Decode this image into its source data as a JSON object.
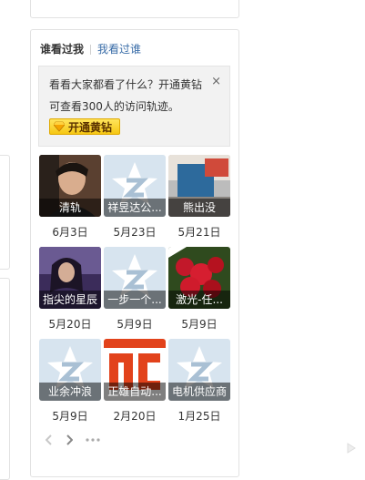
{
  "tabs": {
    "active": "谁看过我",
    "inactive": "我看过谁"
  },
  "notice": {
    "line1": "看看大家都看了什么？开通黄钻",
    "line2": "可查看300人的访问轨迹。",
    "close_glyph": "×",
    "button_label": "开通黄钻"
  },
  "visitors": [
    {
      "name": "清轨",
      "date": "6月3日"
    },
    {
      "name": "祥昱达公...",
      "date": "5月23日"
    },
    {
      "name": "熊出没",
      "date": "5月21日"
    },
    {
      "name": "指尖的星辰",
      "date": "5月20日"
    },
    {
      "name": "一步一个...",
      "date": "5月9日"
    },
    {
      "name": "激光-任...",
      "date": "5月9日"
    },
    {
      "name": "业余冲浪",
      "date": "5月9日"
    },
    {
      "name": "正雄自动...",
      "date": "2月20日"
    },
    {
      "name": "电机供应商",
      "date": "1月25日"
    }
  ],
  "colors": {
    "link": "#3a6da8",
    "vip_yellow": "#f6c714",
    "default_avatar_bg": "#d7e4ef"
  },
  "icons": {
    "prev": "chevron-left-icon",
    "next": "chevron-right-icon",
    "more": "more-dots-icon"
  }
}
